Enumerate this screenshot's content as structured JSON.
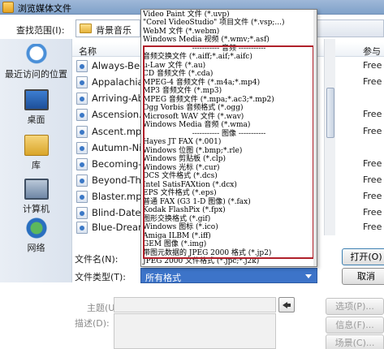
{
  "window": {
    "title": "浏览媒体文件"
  },
  "lookin": {
    "label": "查找范围(I):",
    "value": "背景音乐"
  },
  "places": [
    {
      "label": "最近访问的位置",
      "icon": "recent-places-icon"
    },
    {
      "label": "桌面",
      "icon": "desktop-icon"
    },
    {
      "label": "库",
      "icon": "library-icon"
    },
    {
      "label": "计算机",
      "icon": "computer-icon"
    },
    {
      "label": "网络",
      "icon": "network-icon"
    }
  ],
  "list": {
    "header": {
      "name": "名称",
      "extra": "参与"
    },
    "files": [
      {
        "name": "Always-Be-",
        "extra": "Free"
      },
      {
        "name": "Appalachian",
        "extra": "Free"
      },
      {
        "name": "Arriving-Ab",
        "extra": ""
      },
      {
        "name": "Ascension.m",
        "extra": "Free"
      },
      {
        "name": "Ascent.mp3",
        "extra": "Free"
      },
      {
        "name": "Autumn-Nig",
        "extra": ""
      },
      {
        "name": "Becoming-C",
        "extra": "Free"
      },
      {
        "name": "Beyond-The",
        "extra": "Free"
      },
      {
        "name": "Blaster.mp3",
        "extra": "Free"
      },
      {
        "name": "Blind-Date.n",
        "extra": "Free"
      },
      {
        "name": "Blue-Dream",
        "extra": "Free"
      }
    ]
  },
  "dropdown": {
    "items": [
      "Video Paint 文件 (*.uvp)",
      "\"Corel VideoStudio\" 项目文件 (*.vsp;...)",
      "WebM 文件 (*.webm)",
      "Windows Media 视频 (*.wmv;*.asf)",
      "----------- 音频 -----------",
      "音频交换文件 (*.aiff;*.aif;*.aifc)",
      "u-Law 文件 (*.au)",
      "CD 音频文件 (*.cda)",
      "MPEG-4 音频文件 (*.m4a;*.mp4)",
      "MP3 音频文件 (*.mp3)",
      "MPEG 音频文件 (*.mpa;*.ac3;*.mp2)",
      "Ogg Vorbis 音频格式 (*.ogg)",
      "Microsoft WAV 文件 (*.wav)",
      "Windows Media 音频 (*.wma)",
      "----------- 图像 -----------",
      "Hayes JT FAX (*.001)",
      "Windows 位图 (*.bmp;*.rle)",
      "Windows 剪贴板 (*.clp)",
      "Windows 光标 (*.cur)",
      "DCS 文件格式 (*.dcs)",
      "Intel SatisFAXtion (*.dcx)",
      "EPS 文件格式 (*.eps)",
      "普通 FAX (G3 1-D 图像) (*.fax)",
      "Kodak FlashPix (*.fpx)",
      "图形交换格式 (*.gif)",
      "Windows 图标 (*.ico)",
      "Amiga ILBM (*.iff)",
      "GEM 图像 (*.img)",
      "带图元数据的 JPEG 2000 格式 (*.jp2)",
      "JPEG 2000 文件格式 (*.jpc;*.j2k)"
    ]
  },
  "form": {
    "filename_label": "文件名(N):",
    "filetype_label": "文件类型(T):",
    "filetype_value": "所有格式",
    "subject_label": "主题(U):",
    "desc_label": "描述(D):"
  },
  "buttons": {
    "open": "打开(O)",
    "cancel": "取消",
    "options": "选项(P)...",
    "info": "信息(F)...",
    "scene": "场景(C)..."
  },
  "colors": {
    "highlight_box": "#b0202a",
    "selection_blue": "#3d74c9"
  }
}
